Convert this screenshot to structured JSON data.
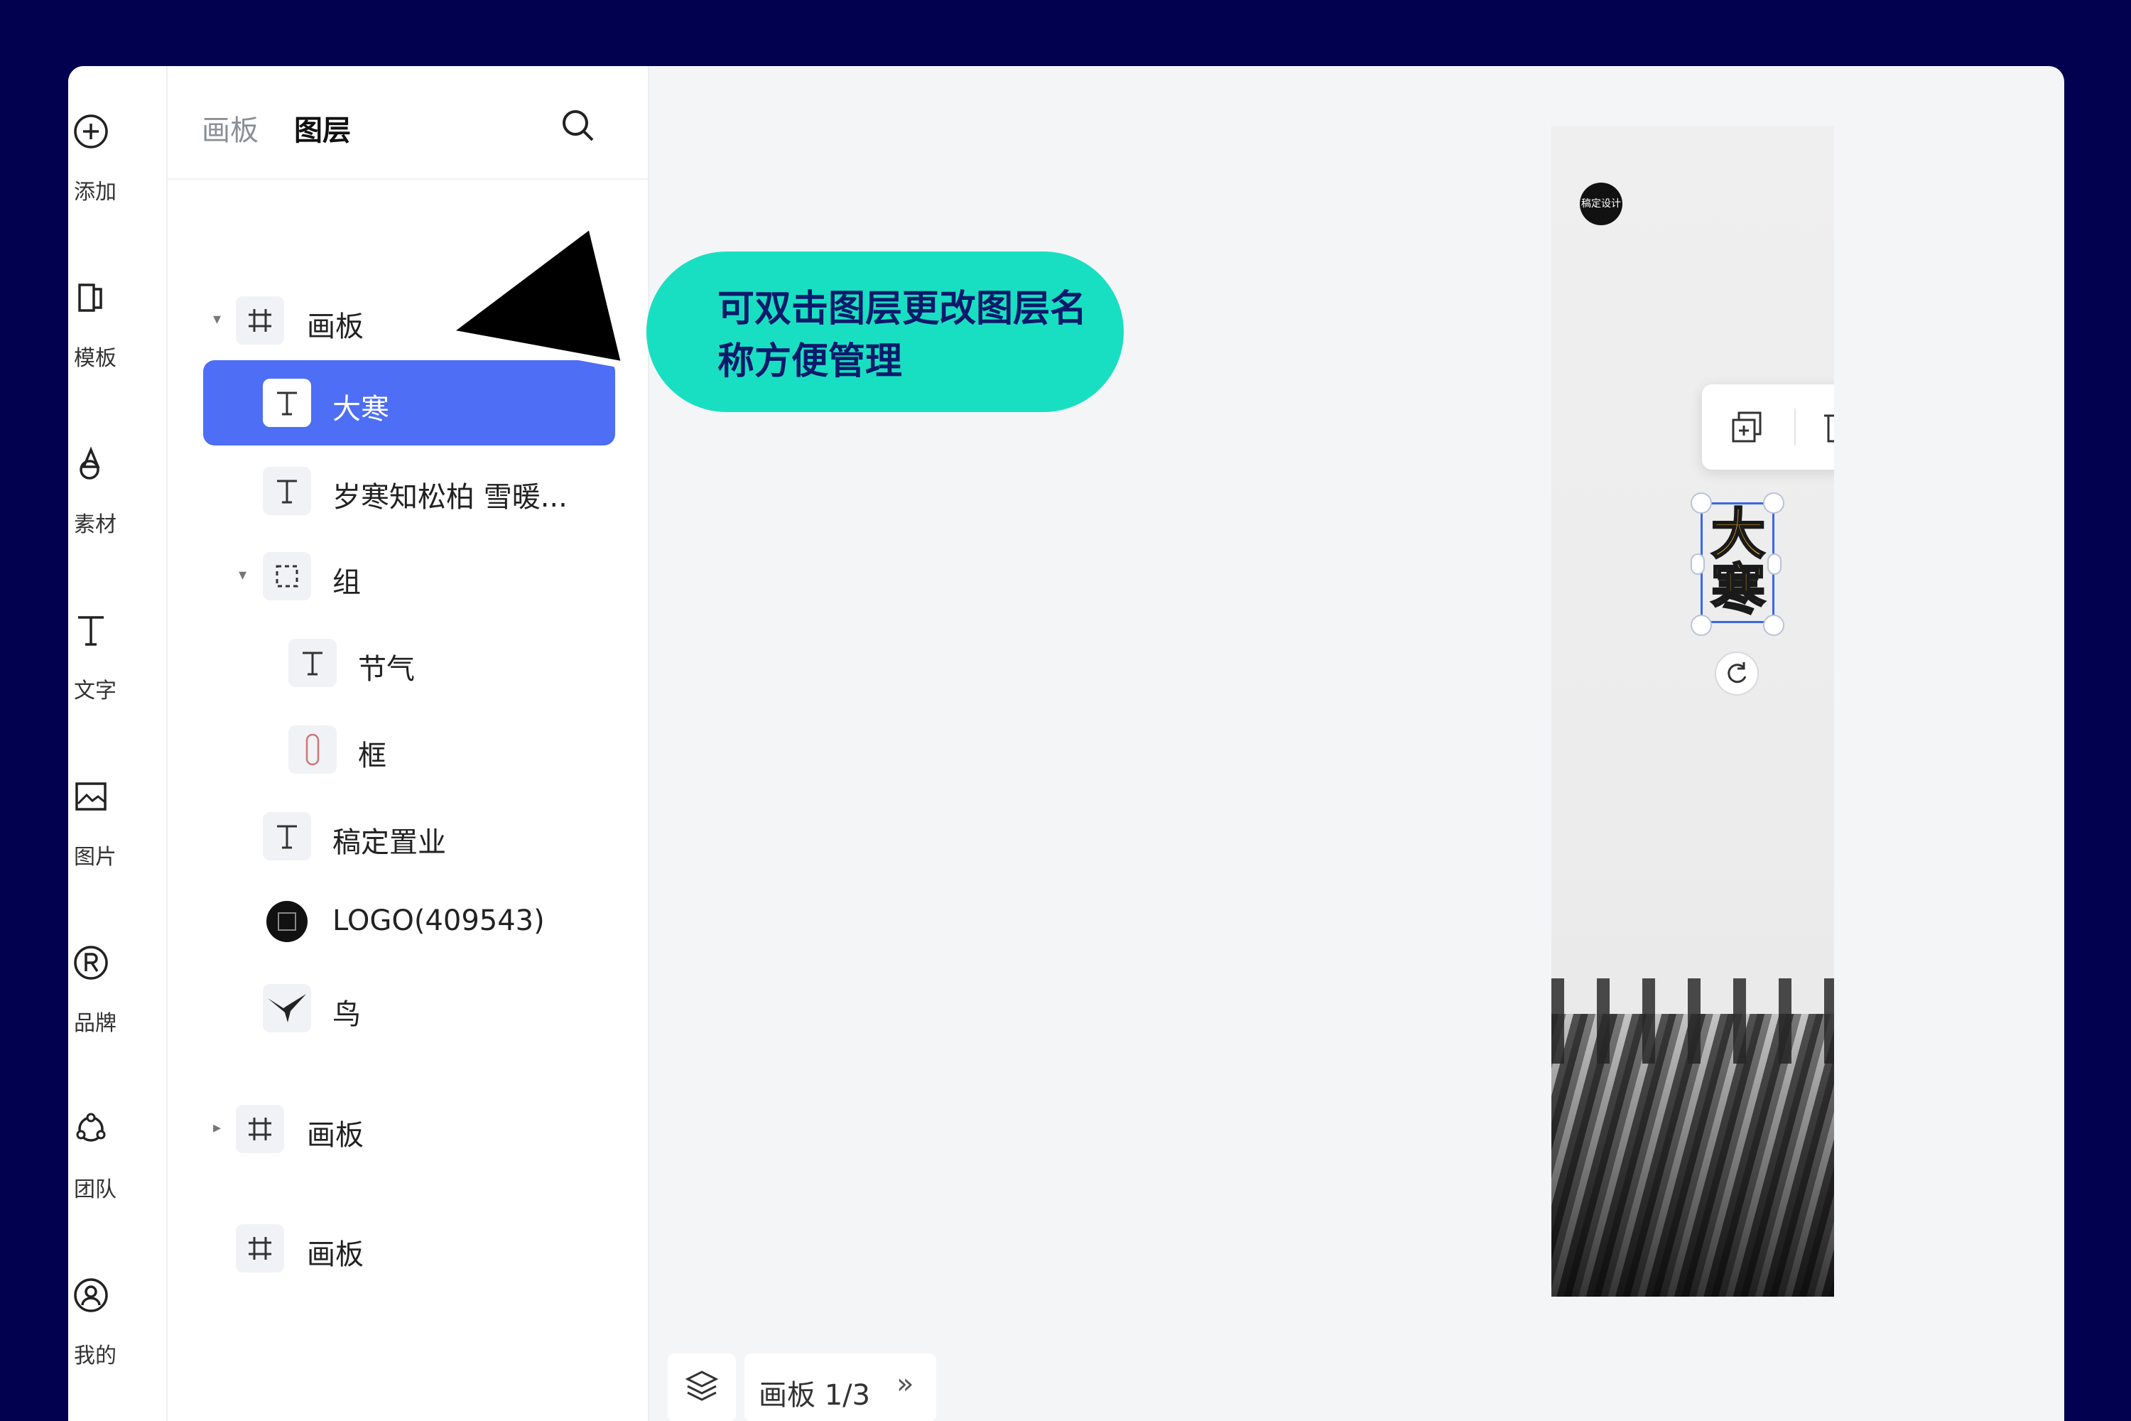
{
  "toolbar": {
    "items": [
      {
        "label": "添加",
        "icon": "add-circle-icon"
      },
      {
        "label": "模板",
        "icon": "template-icon"
      },
      {
        "label": "素材",
        "icon": "material-icon"
      },
      {
        "label": "文字",
        "icon": "text-icon"
      },
      {
        "label": "图片",
        "icon": "image-icon"
      },
      {
        "label": "品牌",
        "icon": "brand-icon"
      },
      {
        "label": "团队",
        "icon": "team-icon"
      },
      {
        "label": "我的",
        "icon": "user-icon"
      }
    ]
  },
  "panel": {
    "tabs": {
      "board": "画板",
      "layer": "图层"
    },
    "search_icon": "search-icon",
    "layers": [
      {
        "name": "画板",
        "type": "artboard",
        "expanded": true
      },
      {
        "name": "大寒",
        "type": "text",
        "selected": true
      },
      {
        "name": "岁寒知松柏 雪暖...",
        "type": "text"
      },
      {
        "name": "组",
        "type": "group",
        "expanded": true
      },
      {
        "name": "节气",
        "type": "text"
      },
      {
        "name": "框",
        "type": "shape"
      },
      {
        "name": "稿定置业",
        "type": "text"
      },
      {
        "name": "LOGO(409543)",
        "type": "image"
      },
      {
        "name": "鸟",
        "type": "image"
      },
      {
        "name": "画板",
        "type": "artboard",
        "expanded": false
      },
      {
        "name": "画板",
        "type": "artboard"
      }
    ]
  },
  "canvas": {
    "selected_text": "大寒",
    "logo_text": "稿定设计"
  },
  "footer": {
    "page_indicator": "画板 1/3",
    "next_symbol": "»"
  },
  "annotation": {
    "text": "可双击图层更改图层名称方便管理"
  },
  "colors": {
    "background": "#01014f",
    "selection": "#4d6ef5",
    "callout": "#19dfc2",
    "callout_text": "#0b1a6b",
    "title_text": "#f6b52d"
  }
}
